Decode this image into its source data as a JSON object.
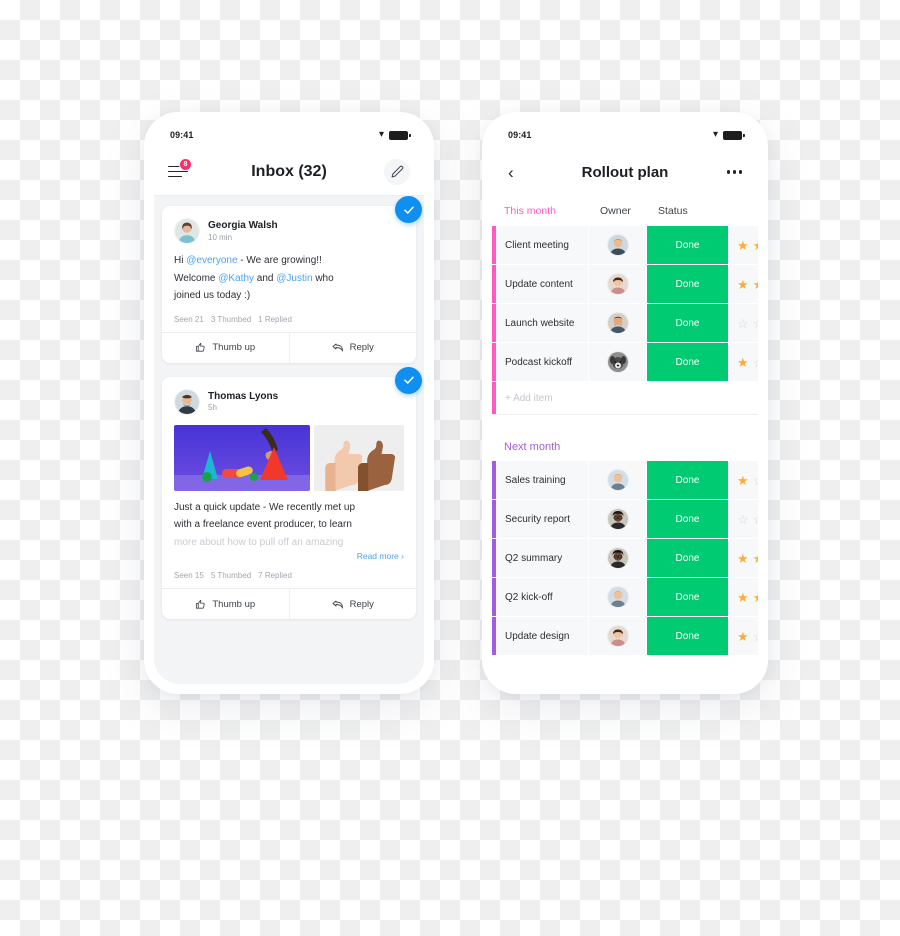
{
  "colors": {
    "accent_blue": "#0f8ff0",
    "mention_blue": "#4aa3f5",
    "badge_red": "#ff2d6a",
    "status_green": "#00ca72",
    "group_pink": "#ff5ac4",
    "group_purple": "#a25ddc",
    "star_on": "#fdab3d",
    "star_off": "#d4d7db"
  },
  "left_phone": {
    "status_bar": {
      "time": "09:41",
      "wifi_icon": "wifi-icon",
      "battery_icon": "battery-icon"
    },
    "header": {
      "menu_icon": "hamburger-menu-icon",
      "menu_badge": "8",
      "title": "Inbox (32)",
      "compose_icon": "pencil-edit-icon"
    },
    "posts": [
      {
        "author": "Georgia Walsh",
        "time": "10 min",
        "check_icon": "checkmark-icon",
        "body_lines": [
          [
            {
              "t": "Hi ",
              "k": "plain"
            },
            {
              "t": "@everyone",
              "k": "mention"
            },
            {
              "t": " - We are growing!!",
              "k": "plain"
            }
          ],
          [
            {
              "t": "Welcome ",
              "k": "plain"
            },
            {
              "t": "@Kathy",
              "k": "mention"
            },
            {
              "t": " and ",
              "k": "plain"
            },
            {
              "t": "@Justin",
              "k": "mention"
            },
            {
              "t": " who",
              "k": "plain"
            }
          ],
          [
            {
              "t": "joined us today :)",
              "k": "plain"
            }
          ]
        ],
        "has_media": false,
        "read_more": "",
        "stats": [
          "Seen 21",
          "3  Thumbed",
          "1  Replied"
        ],
        "actions": [
          {
            "label": "Thumb up",
            "icon": "thumbs-up-icon"
          },
          {
            "label": "Reply",
            "icon": "reply-arrow-icon"
          }
        ]
      },
      {
        "author": "Thomas Lyons",
        "time": "5h",
        "check_icon": "checkmark-icon",
        "body_lines": [
          [
            {
              "t": "Just a quick update - We recently met up",
              "k": "plain"
            }
          ],
          [
            {
              "t": "with a freelance event producer, to learn",
              "k": "plain"
            }
          ],
          [
            {
              "t": "more about how to pull off an amazing",
              "k": "faded"
            }
          ]
        ],
        "has_media": true,
        "media": [
          {
            "name": "shapes-photo",
            "alt": "hand placing red cone among colored shapes on purple background"
          },
          {
            "name": "thumbs-up-photo",
            "alt": "two thumbs up hands"
          }
        ],
        "read_more": "Read more",
        "stats": [
          "Seen 15",
          "5  Thumbed",
          "7  Replied"
        ],
        "actions": [
          {
            "label": "Thumb up",
            "icon": "thumbs-up-icon"
          },
          {
            "label": "Reply",
            "icon": "reply-arrow-icon"
          }
        ]
      }
    ]
  },
  "right_phone": {
    "status_bar": {
      "time": "09:41",
      "wifi_icon": "wifi-icon",
      "battery_icon": "battery-icon"
    },
    "header": {
      "back_icon": "back-chevron-icon",
      "title": "Rollout plan",
      "more_icon": "more-options-icon"
    },
    "columns": {
      "owner": "Owner",
      "status": "Status"
    },
    "groups": [
      {
        "title": "This month",
        "color": "#ff5ac4",
        "rows": [
          {
            "name": "Client meeting",
            "owner_avatar": "avatar-man-1",
            "status": "Done",
            "stars": [
              true,
              true
            ]
          },
          {
            "name": "Update content",
            "owner_avatar": "avatar-woman-1",
            "status": "Done",
            "stars": [
              true,
              true
            ]
          },
          {
            "name": "Launch website",
            "owner_avatar": "avatar-man-2",
            "status": "Done",
            "stars": [
              false,
              false
            ]
          },
          {
            "name": "Podcast kickoff",
            "owner_avatar": "avatar-dog",
            "status": "Done",
            "stars": [
              true,
              false
            ]
          }
        ],
        "add_item": "+ Add item"
      },
      {
        "title": "Next month",
        "color": "#a25ddc",
        "rows": [
          {
            "name": "Sales training",
            "owner_avatar": "avatar-man-3",
            "status": "Done",
            "stars": [
              true,
              false
            ]
          },
          {
            "name": "Security report",
            "owner_avatar": "avatar-woman-2",
            "status": "Done",
            "stars": [
              false,
              false
            ]
          },
          {
            "name": "Q2 summary",
            "owner_avatar": "avatar-woman-2",
            "status": "Done",
            "stars": [
              true,
              true
            ]
          },
          {
            "name": "Q2 kick-off",
            "owner_avatar": "avatar-man-3",
            "status": "Done",
            "stars": [
              true,
              true
            ]
          },
          {
            "name": "Update design",
            "owner_avatar": "avatar-woman-1",
            "status": "Done",
            "stars": [
              true,
              false
            ]
          }
        ],
        "add_item": ""
      }
    ]
  }
}
